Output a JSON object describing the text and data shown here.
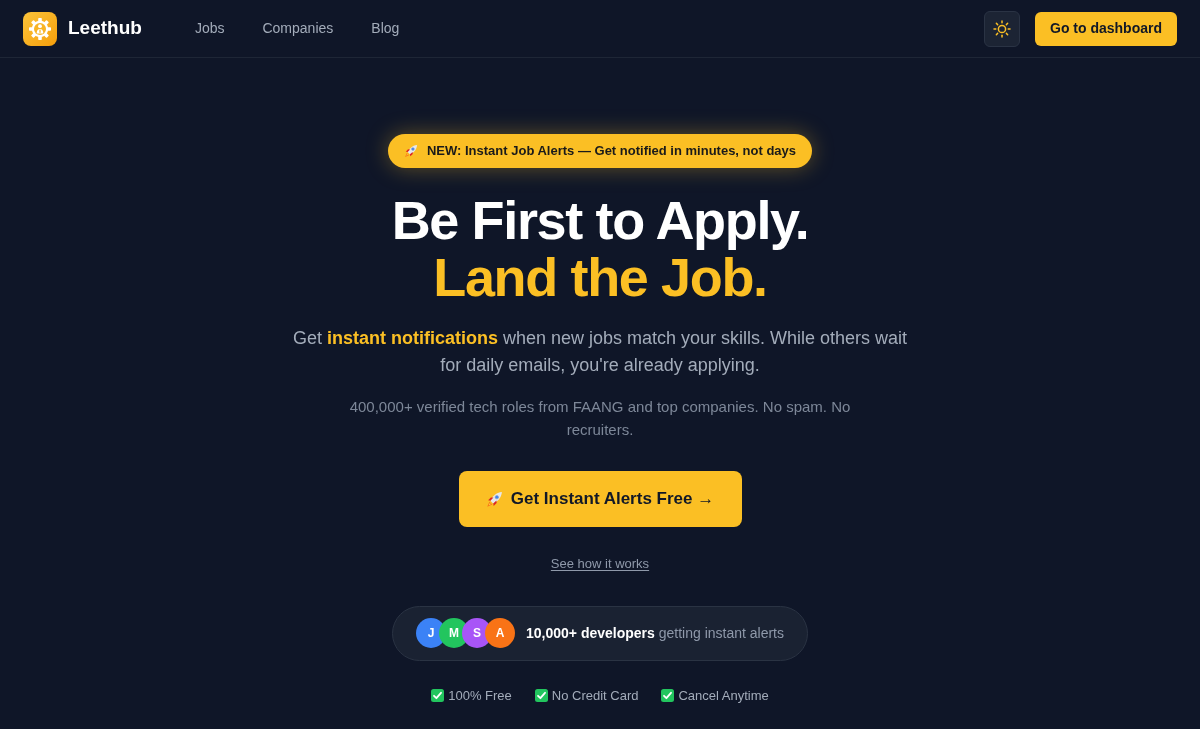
{
  "header": {
    "brand": "Leethub",
    "nav": [
      {
        "label": "Jobs"
      },
      {
        "label": "Companies"
      },
      {
        "label": "Blog"
      }
    ],
    "dashboard_button": "Go to dashboard"
  },
  "hero": {
    "announcement": "NEW: Instant Job Alerts — Get notified in minutes, not days",
    "headline": [
      {
        "text": "Be First to Apply.",
        "highlight": false
      },
      {
        "text": "Land the Job.",
        "highlight": true
      }
    ],
    "subtitle": "Get **instant notifications** when new jobs match your skills. While others wait for daily emails, you're already applying.",
    "note": "400,000+ verified tech roles from FAANG and top companies. No spam. No recruiters.",
    "cta_button": "Get Instant Alerts Free →",
    "secondary_link": "See how it works",
    "social_proof": {
      "avatars": [
        {
          "initial": "J",
          "color": "#3b82f6"
        },
        {
          "initial": "M",
          "color": "#22c55e"
        },
        {
          "initial": "S",
          "color": "#a855f7"
        },
        {
          "initial": "A",
          "color": "#f97316"
        }
      ],
      "text": "**10,000+ developers** getting instant alerts"
    },
    "features": [
      {
        "label": "100% Free"
      },
      {
        "label": "No Credit Card"
      },
      {
        "label": "Cancel Anytime"
      }
    ]
  }
}
